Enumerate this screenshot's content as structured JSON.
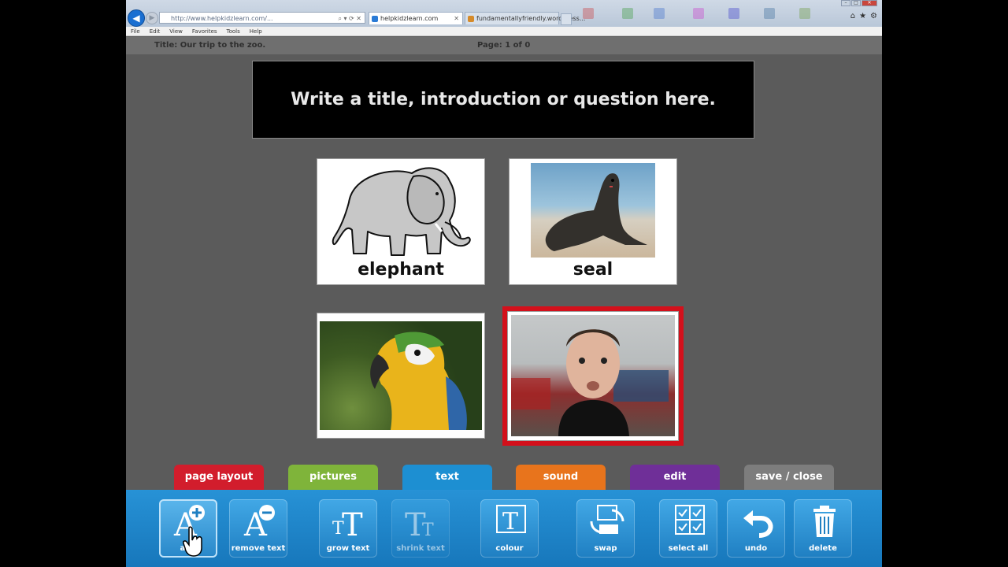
{
  "browser": {
    "address": "http://www.helpkidzlearn.com/...",
    "tabs": [
      {
        "label": "helpkidzlearn.com"
      },
      {
        "label": "fundamentallyfriendly.wordpress..."
      }
    ],
    "menu": [
      "File",
      "Edit",
      "View",
      "Favorites",
      "Tools",
      "Help"
    ]
  },
  "page_header": {
    "title": "Title: Our trip to the zoo.",
    "page": "Page: 1 of 0"
  },
  "banner": {
    "text": "Write a title, introduction or question here."
  },
  "cards": [
    {
      "caption": "elephant",
      "image": "elephant-symbol"
    },
    {
      "caption": "seal",
      "image": "seal-photo"
    },
    {
      "caption": "",
      "image": "parrot-photo"
    },
    {
      "caption": "",
      "image": "person-photo",
      "selected": true
    }
  ],
  "categories": [
    {
      "label": "page layout",
      "color": "#d21d2c"
    },
    {
      "label": "pictures",
      "color": "#7fb43a"
    },
    {
      "label": "text",
      "color": "#1d8fd2",
      "active": true
    },
    {
      "label": "sound",
      "color": "#e8741c"
    },
    {
      "label": "edit",
      "color": "#6f2f98"
    },
    {
      "label": "save / close",
      "color": "#7d7d7d"
    }
  ],
  "tools": [
    {
      "label": "add",
      "icon": "add-text-icon"
    },
    {
      "label": "remove text",
      "icon": "remove-text-icon"
    },
    {
      "label": "grow text",
      "icon": "grow-text-icon"
    },
    {
      "label": "shrink text",
      "icon": "shrink-text-icon",
      "disabled": true
    },
    {
      "label": "colour",
      "icon": "colour-icon"
    },
    {
      "label": "swap",
      "icon": "swap-icon"
    },
    {
      "label": "select all",
      "icon": "select-all-icon"
    },
    {
      "label": "undo",
      "icon": "undo-icon"
    },
    {
      "label": "delete",
      "icon": "delete-icon"
    }
  ]
}
